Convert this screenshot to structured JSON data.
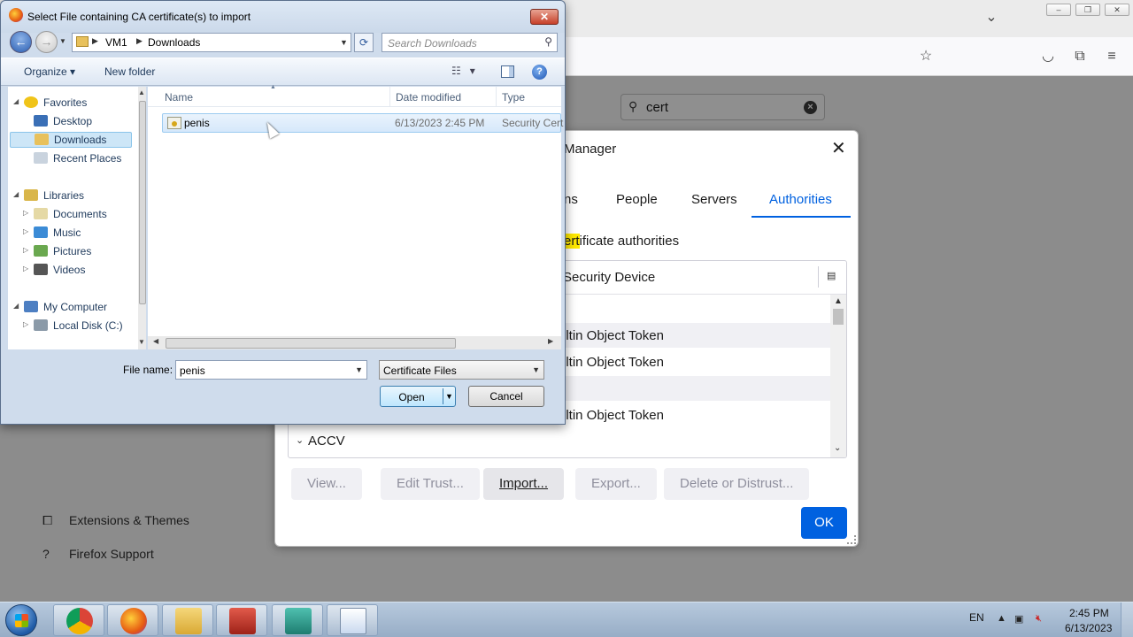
{
  "firefox": {
    "search_value": "cert",
    "sidebar": {
      "extensions_label": "Extensions & Themes",
      "support_label": "Firefox Support"
    }
  },
  "cert_manager": {
    "title": "Manager",
    "tabs": [
      "ns",
      "People",
      "Servers",
      "Authorities"
    ],
    "active_tab": "Authorities",
    "description_highlight": "ert",
    "description_prefix": "",
    "description_rest": "ificate authorities",
    "column_header": "Security Device",
    "rows": [
      {
        "device": ""
      },
      {
        "device": "iltin Object Token"
      },
      {
        "device": "iltin Object Token"
      },
      {
        "device": ""
      },
      {
        "device": "iltin Object Token"
      }
    ],
    "group_label": "ACCV",
    "buttons": {
      "view": "View...",
      "edit_trust": "Edit Trust...",
      "import": "Import...",
      "export": "Export...",
      "delete": "Delete or Distrust..."
    },
    "ok_label": "OK",
    "accent_color": "#0061e0"
  },
  "file_dialog": {
    "title": "Select File containing CA certificate(s) to import",
    "path": [
      "VM1",
      "Downloads"
    ],
    "search_placeholder": "Search Downloads",
    "toolbar": {
      "organize": "Organize",
      "new_folder": "New folder"
    },
    "nav": {
      "favorites": "Favorites",
      "desktop": "Desktop",
      "downloads": "Downloads",
      "recent": "Recent Places",
      "libraries": "Libraries",
      "documents": "Documents",
      "music": "Music",
      "pictures": "Pictures",
      "videos": "Videos",
      "computer": "My Computer",
      "local_disk": "Local Disk (C:)"
    },
    "columns": {
      "name": "Name",
      "date": "Date modified",
      "type": "Type"
    },
    "files": [
      {
        "name": "penis",
        "date": "6/13/2023 2:45 PM",
        "type": "Security Cert"
      }
    ],
    "file_name_label": "File name:",
    "file_name_value": "penis",
    "file_type_value": "Certificate Files",
    "open_label": "Open",
    "cancel_label": "Cancel"
  },
  "taskbar": {
    "language": "EN",
    "time": "2:45 PM",
    "date": "6/13/2023"
  }
}
